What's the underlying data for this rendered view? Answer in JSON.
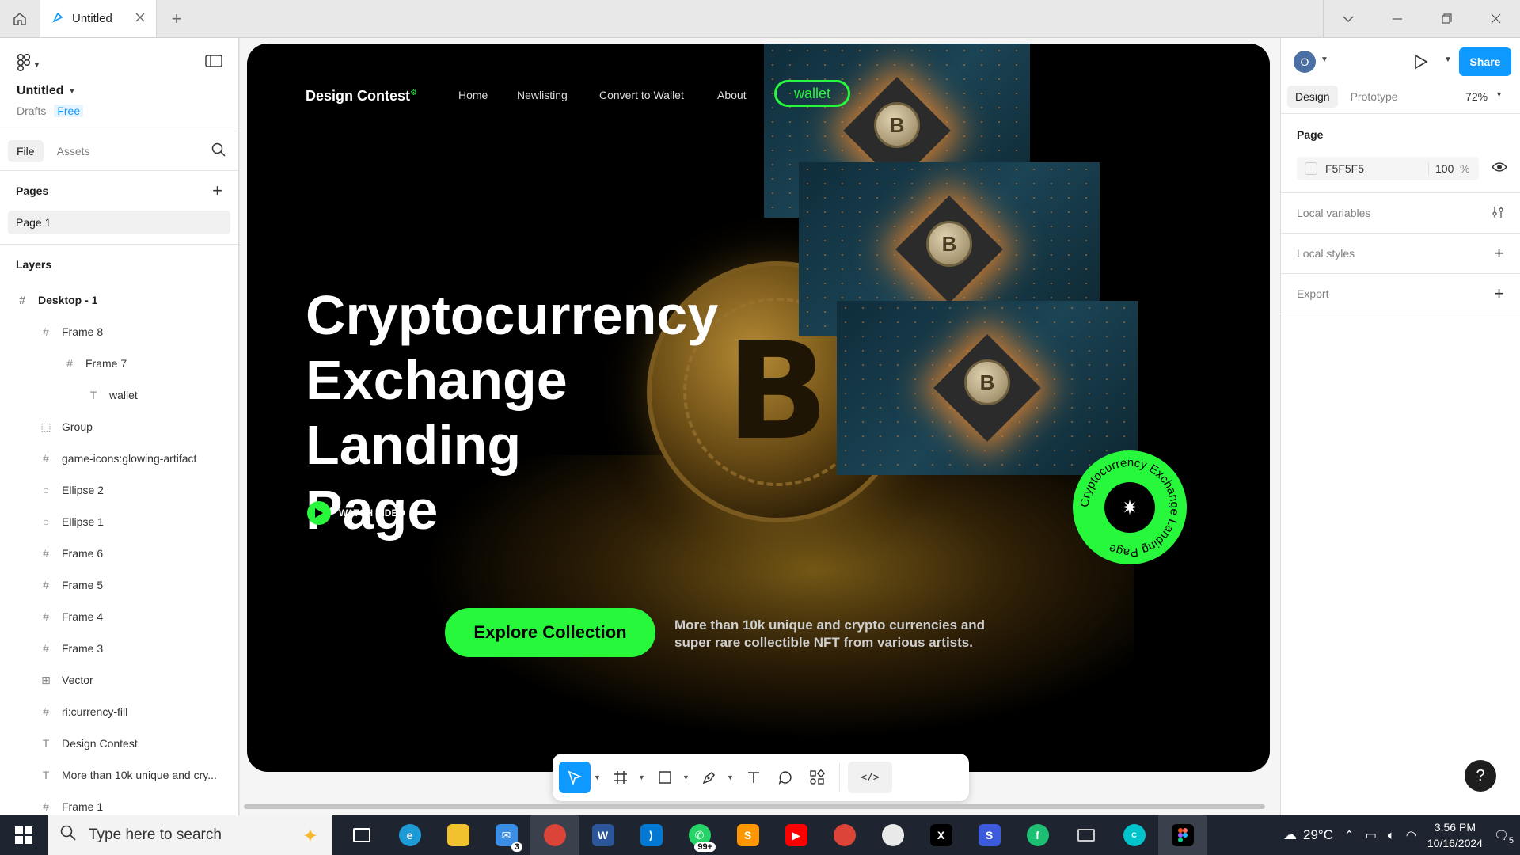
{
  "titlebar": {
    "tab_label": "Untitled",
    "icons": [
      "home-icon",
      "figma-file-icon",
      "close-icon",
      "plus-icon",
      "chevron-down-icon",
      "minimize-icon",
      "restore-icon",
      "window-close-icon"
    ]
  },
  "left_panel": {
    "file_name": "Untitled",
    "drafts_label": "Drafts",
    "plan_label": "Free",
    "tabs": [
      "File",
      "Assets"
    ],
    "pages_heading": "Pages",
    "pages": [
      "Page 1"
    ],
    "layers_heading": "Layers",
    "layers": [
      {
        "name": "Desktop - 1",
        "icon": "frame-icon"
      },
      {
        "name": "Frame 8",
        "icon": "frame-icon"
      },
      {
        "name": "Frame 7",
        "icon": "frame-icon"
      },
      {
        "name": "wallet",
        "icon": "text-icon"
      },
      {
        "name": "Group",
        "icon": "group-icon"
      },
      {
        "name": "game-icons:glowing-artifact",
        "icon": "frame-icon"
      },
      {
        "name": "Ellipse 2",
        "icon": "ellipse-icon"
      },
      {
        "name": "Ellipse 1",
        "icon": "ellipse-icon"
      },
      {
        "name": "Frame 6",
        "icon": "frame-icon"
      },
      {
        "name": "Frame 5",
        "icon": "frame-icon"
      },
      {
        "name": "Frame 4",
        "icon": "frame-icon"
      },
      {
        "name": "Frame 3",
        "icon": "frame-icon"
      },
      {
        "name": "Vector",
        "icon": "vector-icon"
      },
      {
        "name": "ri:currency-fill",
        "icon": "frame-icon"
      },
      {
        "name": "Design Contest",
        "icon": "text-icon"
      },
      {
        "name": "More than 10k unique and cry...",
        "icon": "text-icon"
      },
      {
        "name": "Frame 1",
        "icon": "frame-icon"
      }
    ]
  },
  "artboard": {
    "brand": "Design Contest",
    "nav_links": [
      "Home",
      "Newlisting",
      "Convert to Wallet",
      "About"
    ],
    "wallet_button": "wallet",
    "hero_lines": [
      "Cryptocurrency",
      "Exchange Landing",
      "Page"
    ],
    "watch_video": "WATCH VIDEO",
    "explore_button": "Explore Collection",
    "explore_desc": "More than 10k unique and crypto currencies and super rare collectible NFT from various artists.",
    "badge_ring_text": "Cryptocurrency Exchange Landing Page",
    "chip_symbol": "B",
    "accent_color": "#27f83b"
  },
  "toolbar": {
    "tools": [
      "move-tool",
      "frame-tool",
      "shape-tool",
      "pen-tool",
      "text-tool",
      "comment-tool",
      "actions-tool",
      "dev-mode-toggle"
    ]
  },
  "right_panel": {
    "avatar_letter": "O",
    "share_label": "Share",
    "tabs": [
      "Design",
      "Prototype"
    ],
    "zoom": "72%",
    "page_heading": "Page",
    "page_color": "F5F5F5",
    "page_opacity": "100",
    "opacity_unit": "%",
    "rows": [
      "Local variables",
      "Local styles",
      "Export"
    ],
    "help_label": "?"
  },
  "taskbar": {
    "search_placeholder": "Type here to search",
    "weather": "29°C",
    "time": "3:56 PM",
    "date": "10/16/2024",
    "mail_badge": "3",
    "whatsapp_badge": "99+",
    "notification_count": "5"
  }
}
